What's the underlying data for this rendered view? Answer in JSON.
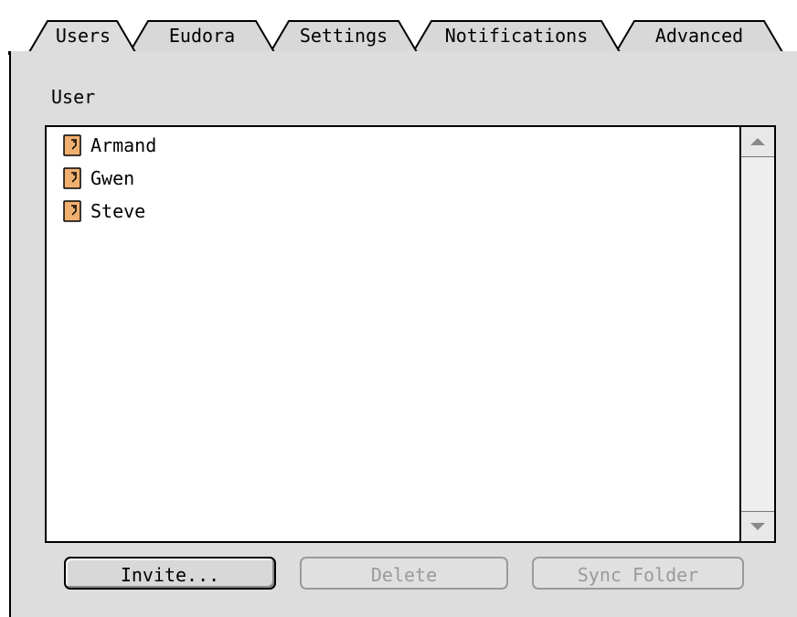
{
  "tabs": [
    {
      "label": "Users",
      "selected": true
    },
    {
      "label": "Eudora",
      "selected": false
    },
    {
      "label": "Settings",
      "selected": false
    },
    {
      "label": "Notifications",
      "selected": false
    },
    {
      "label": "Advanced",
      "selected": false
    }
  ],
  "panel": {
    "section_label": "User",
    "users": [
      {
        "name": "Armand",
        "icon": "user-card-icon"
      },
      {
        "name": "Gwen",
        "icon": "user-card-icon"
      },
      {
        "name": "Steve",
        "icon": "user-card-icon"
      }
    ],
    "scrollbar": {
      "up_icon": "scroll-up-arrow-icon",
      "down_icon": "scroll-down-arrow-icon"
    },
    "buttons": {
      "invite": "Invite...",
      "delete": "Delete",
      "sync_folder": "Sync Folder"
    }
  },
  "colors": {
    "panel_bg": "#dddddd",
    "disabled_text": "#9a9a9a",
    "icon_fill": "#f0b070"
  }
}
